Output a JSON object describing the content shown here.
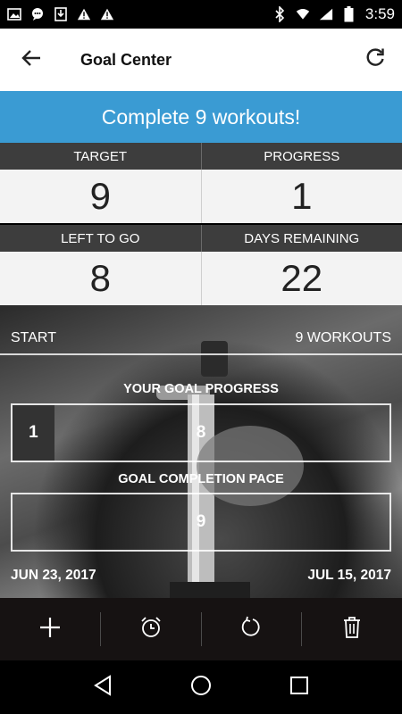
{
  "status_bar": {
    "left_icons": [
      "image-icon",
      "chat-icon",
      "download-icon",
      "warning-icon",
      "warning-icon"
    ],
    "right_icons": [
      "bluetooth-icon",
      "wifi-icon",
      "signal-icon",
      "battery-icon"
    ],
    "time": "3:59"
  },
  "app_bar": {
    "title": "Goal Center"
  },
  "banner": {
    "text": "Complete 9 workouts!"
  },
  "stats": {
    "target_label": "TARGET",
    "target_value": "9",
    "progress_label": "PROGRESS",
    "progress_value": "1",
    "left_label": "LEFT TO GO",
    "left_value": "8",
    "days_label": "DAYS REMAINING",
    "days_value": "22"
  },
  "timeline": {
    "start_label": "START",
    "end_label": "9 WORKOUTS"
  },
  "goal_progress": {
    "label": "YOUR GOAL PROGRESS",
    "done": "1",
    "remaining": "8",
    "fraction": 0.111
  },
  "pace": {
    "label": "GOAL COMPLETION PACE",
    "value": "9"
  },
  "dates": {
    "start": "JUN 23, 2017",
    "end": "JUL 15, 2017"
  },
  "toolbar": {
    "icons": [
      "add-icon",
      "alarm-clock-icon",
      "reset-icon",
      "trash-icon"
    ]
  }
}
